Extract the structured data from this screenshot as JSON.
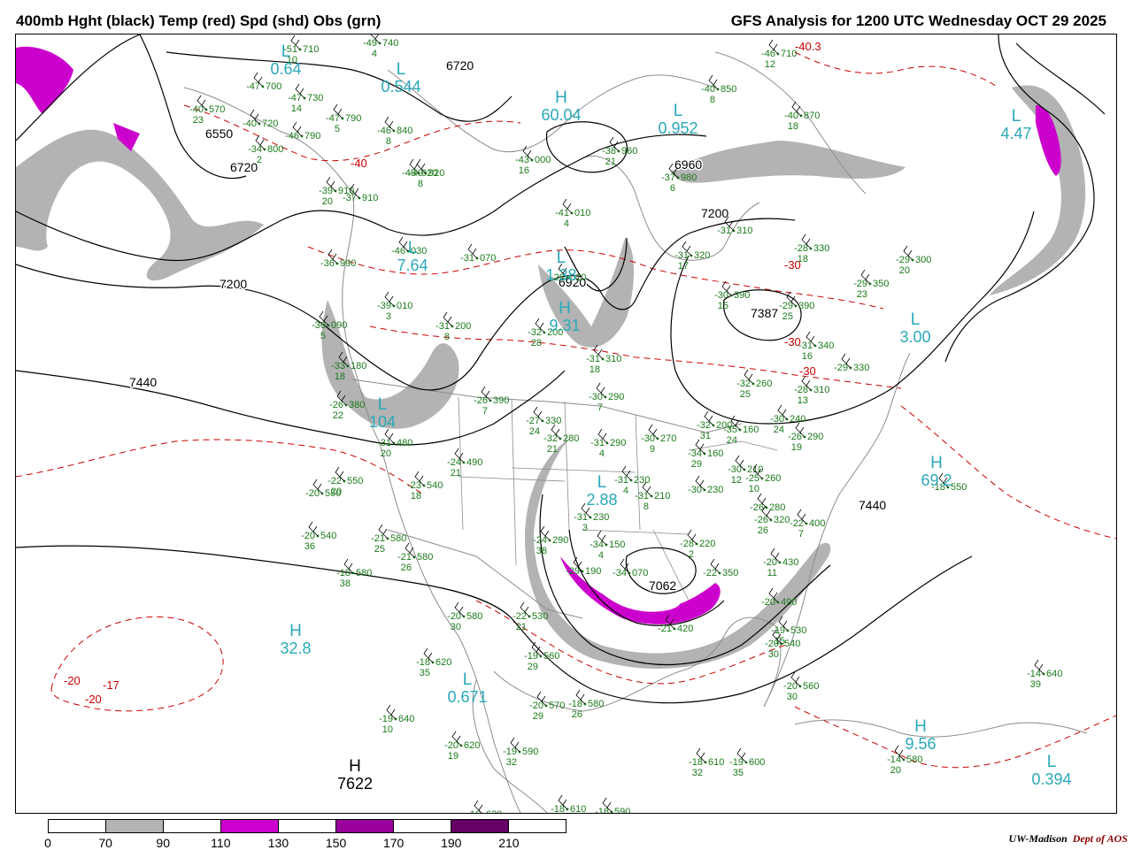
{
  "header": {
    "left_title": "400mb Hght (black) Temp (red) Spd (shd) Obs (grn)",
    "right_title": "GFS Analysis for 1200 UTC Wednesday  OCT 29 2025"
  },
  "colors": {
    "height_contour": "#000000",
    "temperature_contour": "#cc0000",
    "observation": "#1a7a1a",
    "center_label": "#2aa8b8",
    "speed_70_90": "#b3b3b3",
    "speed_110_130": "#cc00cc",
    "speed_130_150": "#ffffff",
    "speed_150_170": "#990099",
    "speed_190_210": "#660066",
    "geography": "#8c8c8c"
  },
  "height_labels": [
    {
      "text": "6720"
    },
    {
      "text": "6720"
    },
    {
      "text": "6550"
    },
    {
      "text": "6960"
    },
    {
      "text": "7200"
    },
    {
      "text": "7200"
    },
    {
      "text": "7440"
    },
    {
      "text": "7440"
    },
    {
      "text": "6920"
    },
    {
      "text": "7062"
    },
    {
      "text": "7387"
    }
  ],
  "centers": [
    {
      "letter": "L",
      "value": "0.64"
    },
    {
      "letter": "L",
      "value": "0.544"
    },
    {
      "letter": "H",
      "value": "60.04"
    },
    {
      "letter": "L",
      "value": "0.952"
    },
    {
      "letter": "L",
      "value": "4.47"
    },
    {
      "letter": "L",
      "value": "7.64"
    },
    {
      "letter": "L",
      "value": "1.38"
    },
    {
      "letter": "H",
      "value": "9.31"
    },
    {
      "letter": "L",
      "value": "3.00"
    },
    {
      "letter": "L",
      "value": "104"
    },
    {
      "letter": "L",
      "value": "2.88"
    },
    {
      "letter": "H",
      "value": "69.2"
    },
    {
      "letter": "H",
      "value": "32.8"
    },
    {
      "letter": "L",
      "value": "0.671"
    },
    {
      "letter": "L",
      "value": "0.394"
    },
    {
      "letter": "H",
      "value": "9.56"
    },
    {
      "letter": "H",
      "value": "7622"
    }
  ],
  "temperature_labels": [
    {
      "text": "-40"
    },
    {
      "text": "-30"
    },
    {
      "text": "-30"
    },
    {
      "text": "-30"
    },
    {
      "text": "-20"
    },
    {
      "text": "-20"
    },
    {
      "text": "-17"
    },
    {
      "text": "-40.3"
    }
  ],
  "observations": [
    {
      "temp": "-51",
      "height": "710",
      "dew": "10"
    },
    {
      "temp": "-49",
      "height": "740",
      "dew": "4"
    },
    {
      "temp": "-47",
      "height": "700",
      "dew": ""
    },
    {
      "temp": "-40",
      "height": "570",
      "dew": "23"
    },
    {
      "temp": "-40",
      "height": "720",
      "dew": ""
    },
    {
      "temp": "-47",
      "height": "730",
      "dew": "14"
    },
    {
      "temp": "-47",
      "height": "790",
      "dew": "5"
    },
    {
      "temp": "-46",
      "height": "790",
      "dew": ""
    },
    {
      "temp": "-34",
      "height": "800",
      "dew": "2"
    },
    {
      "temp": "-46",
      "height": "840",
      "dew": "8"
    },
    {
      "temp": "-45",
      "height": "920",
      "dew": ""
    },
    {
      "temp": "-40",
      "height": "850",
      "dew": "8"
    },
    {
      "temp": "-46",
      "height": "710",
      "dew": "12"
    },
    {
      "temp": "-40",
      "height": "870",
      "dew": "18"
    },
    {
      "temp": "-43",
      "height": "000",
      "dew": "16"
    },
    {
      "temp": "-38",
      "height": "960",
      "dew": "21"
    },
    {
      "temp": "-37",
      "height": "980",
      "dew": "6"
    },
    {
      "temp": "-39",
      "height": "910",
      "dew": "20"
    },
    {
      "temp": "-37",
      "height": "910",
      "dew": ""
    },
    {
      "temp": "-49",
      "height": "920",
      "dew": "8"
    },
    {
      "temp": "-41",
      "height": "010",
      "dew": "4"
    },
    {
      "temp": "-31",
      "height": "310",
      "dew": ""
    },
    {
      "temp": "-28",
      "height": "330",
      "dew": "18"
    },
    {
      "temp": "-29",
      "height": "300",
      "dew": "20"
    },
    {
      "temp": "-31",
      "height": "320",
      "dew": "17"
    },
    {
      "temp": "-29",
      "height": "350",
      "dew": "23"
    },
    {
      "temp": "-36",
      "height": "990",
      "dew": ""
    },
    {
      "temp": "-46",
      "height": "030",
      "dew": ""
    },
    {
      "temp": "-31",
      "height": "070",
      "dew": ""
    },
    {
      "temp": "-29",
      "height": "010",
      "dew": ""
    },
    {
      "temp": "-30",
      "height": "390",
      "dew": "15"
    },
    {
      "temp": "-29",
      "height": "390",
      "dew": "25"
    },
    {
      "temp": "-39",
      "height": "010",
      "dew": "3"
    },
    {
      "temp": "-31",
      "height": "200",
      "dew": "8"
    },
    {
      "temp": "-32",
      "height": "200",
      "dew": "28"
    },
    {
      "temp": "-31",
      "height": "340",
      "dew": "16"
    },
    {
      "temp": "-29",
      "height": "330",
      "dew": ""
    },
    {
      "temp": "-36",
      "height": "090",
      "dew": "5"
    },
    {
      "temp": "-31",
      "height": "310",
      "dew": "18"
    },
    {
      "temp": "-32",
      "height": "260",
      "dew": "25"
    },
    {
      "temp": "-28",
      "height": "310",
      "dew": "13"
    },
    {
      "temp": "-33",
      "height": "180",
      "dew": "18"
    },
    {
      "temp": "-30",
      "height": "290",
      "dew": "7"
    },
    {
      "temp": "-26",
      "height": "390",
      "dew": "7"
    },
    {
      "temp": "-30",
      "height": "240",
      "dew": "24"
    },
    {
      "temp": "-26",
      "height": "290",
      "dew": "19"
    },
    {
      "temp": "-26",
      "height": "380",
      "dew": "22"
    },
    {
      "temp": "-27",
      "height": "330",
      "dew": "24"
    },
    {
      "temp": "-32",
      "height": "280",
      "dew": "21"
    },
    {
      "temp": "-31",
      "height": "290",
      "dew": "4"
    },
    {
      "temp": "-30",
      "height": "270",
      "dew": "9"
    },
    {
      "temp": "-32",
      "height": "200",
      "dew": "31"
    },
    {
      "temp": "-35",
      "height": "160",
      "dew": "24"
    },
    {
      "temp": "-34",
      "height": "160",
      "dew": "29"
    },
    {
      "temp": "-30",
      "height": "210",
      "dew": "12"
    },
    {
      "temp": "-25",
      "height": "260",
      "dew": "10"
    },
    {
      "temp": "-31",
      "height": "480",
      "dew": "20"
    },
    {
      "temp": "-24",
      "height": "490",
      "dew": "21"
    },
    {
      "temp": "-23",
      "height": "540",
      "dew": "18"
    },
    {
      "temp": "-22",
      "height": "550",
      "dew": "20"
    },
    {
      "temp": "-20",
      "height": "550",
      "dew": ""
    },
    {
      "temp": "-31",
      "height": "230",
      "dew": "4"
    },
    {
      "temp": "-31",
      "height": "210",
      "dew": "8"
    },
    {
      "temp": "-30",
      "height": "230",
      "dew": ""
    },
    {
      "temp": "-26",
      "height": "280",
      "dew": ""
    },
    {
      "temp": "-18",
      "height": "550",
      "dew": ""
    },
    {
      "temp": "-20",
      "height": "540",
      "dew": "36"
    },
    {
      "temp": "-21",
      "height": "580",
      "dew": "25"
    },
    {
      "temp": "-21",
      "height": "580",
      "dew": "26"
    },
    {
      "temp": "-18",
      "height": "580",
      "dew": "38"
    },
    {
      "temp": "-31",
      "height": "230",
      "dew": "3"
    },
    {
      "temp": "-24",
      "height": "290",
      "dew": "38"
    },
    {
      "temp": "-34",
      "height": "150",
      "dew": "4"
    },
    {
      "temp": "-28",
      "height": "220",
      "dew": "2"
    },
    {
      "temp": "-26",
      "height": "320",
      "dew": "26"
    },
    {
      "temp": "-22",
      "height": "400",
      "dew": "7"
    },
    {
      "temp": "-29",
      "height": "190",
      "dew": ""
    },
    {
      "temp": "-34",
      "height": "070",
      "dew": ""
    },
    {
      "temp": "-22",
      "height": "350",
      "dew": ""
    },
    {
      "temp": "-20",
      "height": "430",
      "dew": "11"
    },
    {
      "temp": "-20",
      "height": "490",
      "dew": ""
    },
    {
      "temp": "-20",
      "height": "580",
      "dew": "30"
    },
    {
      "temp": "-22",
      "height": "530",
      "dew": "21"
    },
    {
      "temp": "-21",
      "height": "420",
      "dew": ""
    },
    {
      "temp": "-19",
      "height": "530",
      "dew": "15"
    },
    {
      "temp": "-20",
      "height": "540",
      "dew": "30"
    },
    {
      "temp": "-19",
      "height": "560",
      "dew": "29"
    },
    {
      "temp": "-18",
      "height": "620",
      "dew": "35"
    },
    {
      "temp": "-20",
      "height": "570",
      "dew": "29"
    },
    {
      "temp": "-18",
      "height": "580",
      "dew": "26"
    },
    {
      "temp": "-20",
      "height": "560",
      "dew": "30"
    },
    {
      "temp": "-19",
      "height": "640",
      "dew": "10"
    },
    {
      "temp": "-20",
      "height": "620",
      "dew": "19"
    },
    {
      "temp": "-19",
      "height": "590",
      "dew": "32"
    },
    {
      "temp": "-18",
      "height": "610",
      "dew": "32"
    },
    {
      "temp": "-19",
      "height": "600",
      "dew": "35"
    },
    {
      "temp": "-14",
      "height": "580",
      "dew": "20"
    },
    {
      "temp": "-14",
      "height": "640",
      "dew": "39"
    },
    {
      "temp": "-16",
      "height": "620",
      "dew": ""
    },
    {
      "temp": "-18",
      "height": "610",
      "dew": ""
    },
    {
      "temp": "-18",
      "height": "590",
      "dew": ""
    }
  ],
  "colorbar": {
    "ticks": [
      "0",
      "70",
      "90",
      "110",
      "130",
      "150",
      "170",
      "190",
      "210"
    ],
    "segments": [
      "#ffffff",
      "#b3b3b3",
      "#ffffff",
      "#cc00cc",
      "#ffffff",
      "#990099",
      "#ffffff",
      "#660066",
      "#ffffff"
    ]
  },
  "credit": {
    "institution": "UW-Madison",
    "department": "Dept of AOS"
  }
}
